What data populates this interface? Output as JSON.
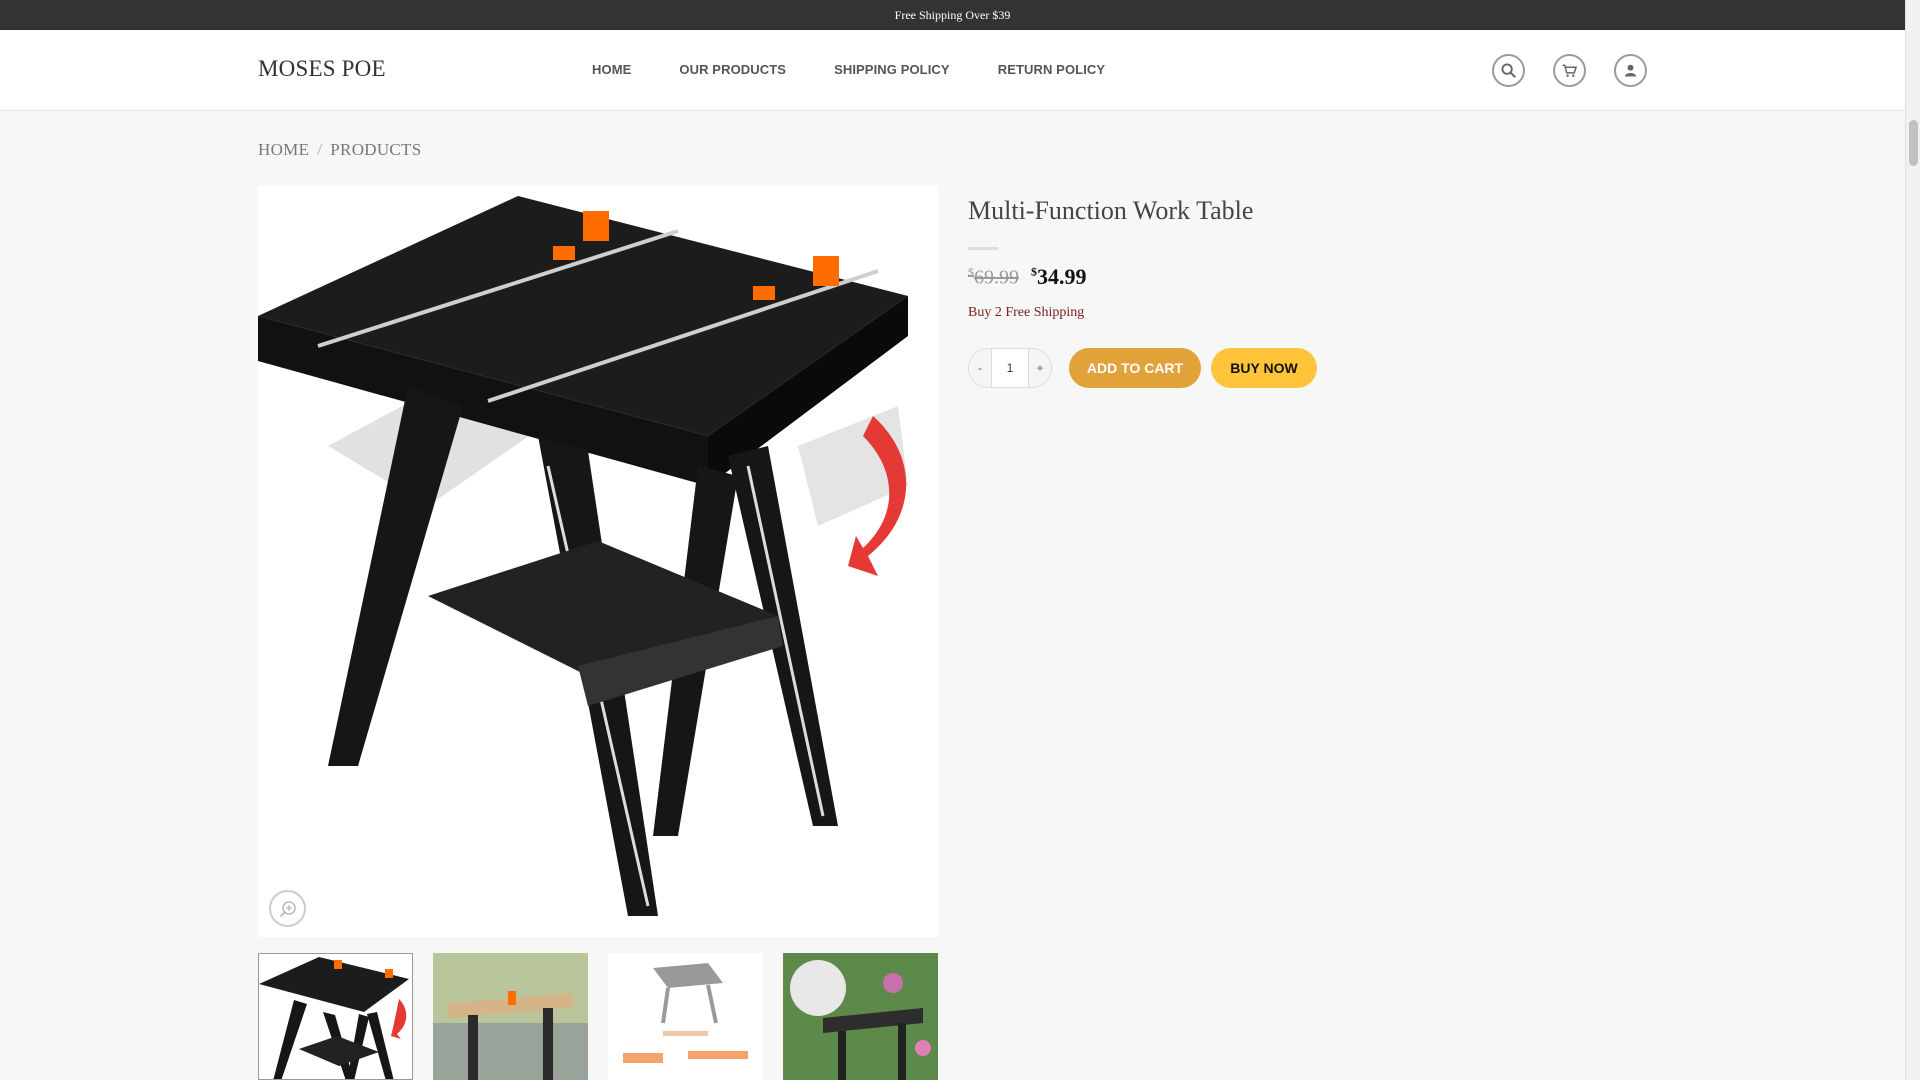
{
  "topbar": {
    "text": "Free Shipping Over $39"
  },
  "header": {
    "logo": "MOSES POE",
    "nav": [
      "HOME",
      "OUR PRODUCTS",
      "SHIPPING POLICY",
      "RETURN POLICY"
    ]
  },
  "breadcrumb": {
    "home": "HOME",
    "separator": "/",
    "current": "PRODUCTS"
  },
  "product": {
    "title": "Multi-Function Work Table",
    "old_price_symbol": "$",
    "old_price": "69.99",
    "new_price_symbol": "$",
    "new_price": "34.99",
    "promo": "Buy 2 Free Shipping",
    "qty_minus": "-",
    "qty_value": "1",
    "qty_plus": "+",
    "add_to_cart": "ADD TO CART",
    "buy_now": "BUY NOW"
  },
  "colors": {
    "add_to_cart": "#e1a23a",
    "buy_now": "#ffc439",
    "topbar": "#333333",
    "promo": "#7a1e1e"
  },
  "icons": {
    "search": "search-icon",
    "cart": "cart-icon",
    "account": "user-icon",
    "zoom": "zoom-in-icon"
  }
}
